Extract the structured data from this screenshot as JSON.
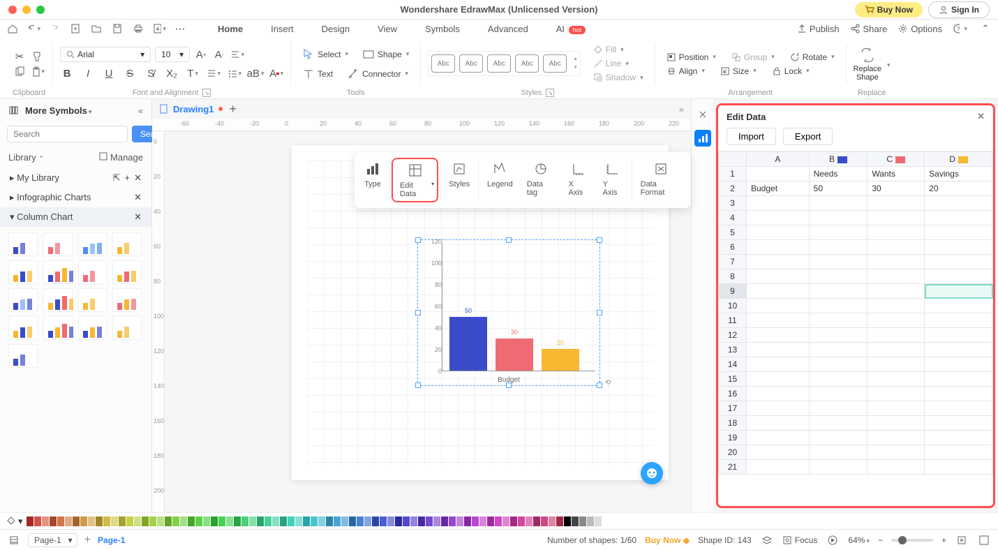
{
  "app_title": "Wondershare EdrawMax (Unlicensed Version)",
  "titlebar": {
    "buy": "Buy Now",
    "signin": "Sign In"
  },
  "tabs": [
    "Home",
    "Insert",
    "Design",
    "View",
    "Symbols",
    "Advanced",
    "AI"
  ],
  "active_tab": "Home",
  "hot": "hot",
  "menu_right": {
    "publish": "Publish",
    "share": "Share",
    "options": "Options"
  },
  "ribbon": {
    "clipboard": "Clipboard",
    "font_align": "Font and Alignment",
    "tools": "Tools",
    "styles": "Styles",
    "arrangement": "Arrangement",
    "replace_group": "Replace",
    "font": "Arial",
    "size": "10",
    "select": "Select",
    "shape": "Shape",
    "text": "Text",
    "connector": "Connector",
    "fill": "Fill",
    "line": "Line",
    "shadow": "Shadow",
    "position": "Position",
    "group": "Group",
    "rotate": "Rotate",
    "align": "Align",
    "sizeb": "Size",
    "lock": "Lock",
    "replace": "Replace\nShape",
    "gallery": [
      "Abc",
      "Abc",
      "Abc",
      "Abc",
      "Abc"
    ]
  },
  "doc": {
    "name": "Drawing1"
  },
  "ruler_h": [
    "-60",
    "-40",
    "-20",
    "0",
    "20",
    "40",
    "60",
    "80",
    "100",
    "120",
    "140",
    "160",
    "180",
    "200",
    "220"
  ],
  "ruler_v": [
    "0",
    "20",
    "40",
    "60",
    "80",
    "100",
    "120",
    "140",
    "160",
    "180",
    "200"
  ],
  "left": {
    "more": "More Symbols",
    "search_ph": "Search",
    "search_btn": "Search",
    "library": "Library",
    "manage": "Manage",
    "mylib": "My Library",
    "info": "Infographic Charts",
    "col": "Column Chart"
  },
  "float": {
    "type": "Type",
    "edit": "Edit Data",
    "styles": "Styles",
    "legend": "Legend",
    "datatag": "Data tag",
    "xaxis": "X Axis",
    "yaxis": "Y Axis",
    "format": "Data Format"
  },
  "chart_data": {
    "type": "bar",
    "categories": [
      "Needs",
      "Wants",
      "Savings"
    ],
    "values": [
      50,
      30,
      20
    ],
    "colors": [
      "#3b4cca",
      "#ef6b73",
      "#f7b731"
    ],
    "row_label": "Budget",
    "ylim": [
      0,
      120
    ],
    "ticks": [
      0,
      20,
      40,
      60,
      80,
      100,
      120
    ],
    "xlabel": "Budget"
  },
  "edit_panel": {
    "title": "Edit Data",
    "import": "Import",
    "export": "Export",
    "cols": [
      "A",
      "B",
      "C",
      "D"
    ],
    "col_colors": [
      "",
      "#3b4cca",
      "#ef6b73",
      "#f7b731"
    ],
    "row1": [
      "",
      "Needs",
      "Wants",
      "Savings"
    ],
    "row2": [
      "Budget",
      "50",
      "30",
      "20"
    ],
    "visible_rows": 21,
    "active_row": 9,
    "active_col": 3
  },
  "status": {
    "page": "Page-1",
    "page_link": "Page-1",
    "shapes": "Number of shapes: 1/60",
    "buy": "Buy Now",
    "shapeid": "Shape ID: 143",
    "focus": "Focus",
    "zoom": "64%"
  }
}
